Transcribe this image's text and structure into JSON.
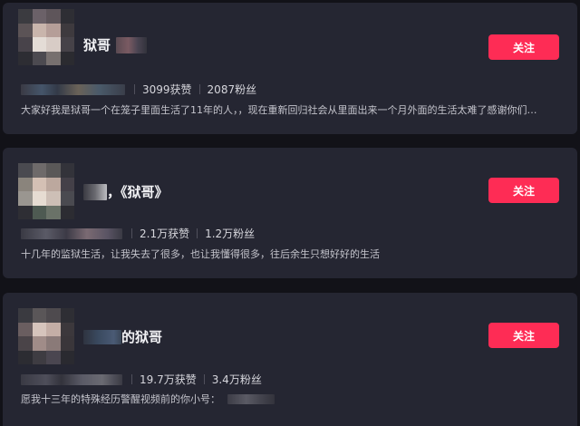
{
  "results": [
    {
      "name": "狱哥",
      "likes": "3099获赞",
      "fans": "2087粉丝",
      "bio": "大家好我是狱哥一个在笼子里面生活了11年的人，，现在重新回归社会从里面出来一个月外面的生活太难了感谢你们的...",
      "follow_label": "关注"
    },
    {
      "name": "，《狱哥》",
      "likes": "2.1万获赞",
      "fans": "1.2万粉丝",
      "bio": "十几年的监狱生活，让我失去了很多，也让我懂得很多，往后余生只想好好的生活",
      "follow_label": "关注"
    },
    {
      "name": "的狱哥",
      "likes": "19.7万获赞",
      "fans": "3.4万粉丝",
      "bio": "愿我十三年的特殊经历警醒视频前的你小号：",
      "follow_label": "关注"
    }
  ],
  "colors": {
    "background": "#121218",
    "card": "#252632",
    "follow_button": "#fe2c55"
  }
}
